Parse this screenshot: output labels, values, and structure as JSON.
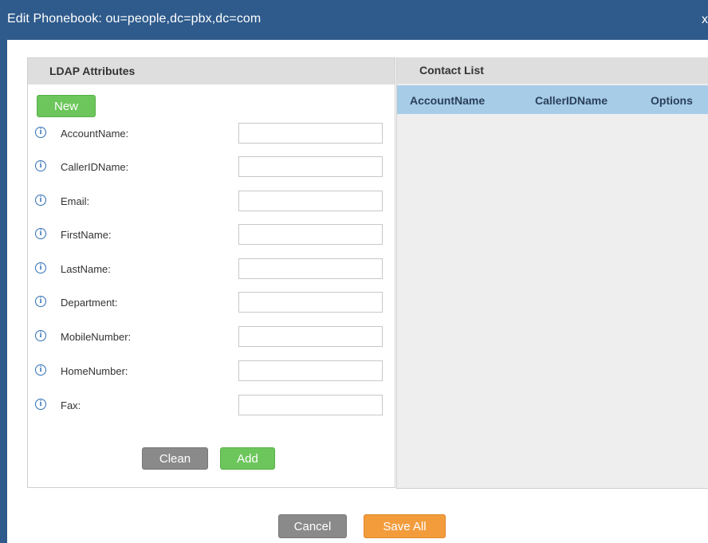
{
  "dialog": {
    "title": "Edit Phonebook: ou=people,dc=pbx,dc=com",
    "close_label": "x"
  },
  "ldap": {
    "header": "LDAP Attributes",
    "new_label": "New",
    "info_glyph": "i",
    "fields": [
      {
        "label": "AccountName:",
        "value": ""
      },
      {
        "label": "CallerIDName:",
        "value": ""
      },
      {
        "label": "Email:",
        "value": ""
      },
      {
        "label": "FirstName:",
        "value": ""
      },
      {
        "label": "LastName:",
        "value": ""
      },
      {
        "label": "Department:",
        "value": ""
      },
      {
        "label": "MobileNumber:",
        "value": ""
      },
      {
        "label": "HomeNumber:",
        "value": ""
      },
      {
        "label": "Fax:",
        "value": ""
      }
    ],
    "clean_label": "Clean",
    "add_label": "Add"
  },
  "contacts": {
    "header": "Contact List",
    "columns": [
      "AccountName",
      "CallerIDName",
      "Options"
    ],
    "rows": []
  },
  "footer": {
    "cancel_label": "Cancel",
    "save_label": "Save All"
  },
  "colors": {
    "titlebar": "#2f5b8c",
    "green_button": "#6cc65b",
    "gray_button": "#8a8a8a",
    "orange_button": "#f39c3c",
    "table_header": "#a7cce8"
  }
}
